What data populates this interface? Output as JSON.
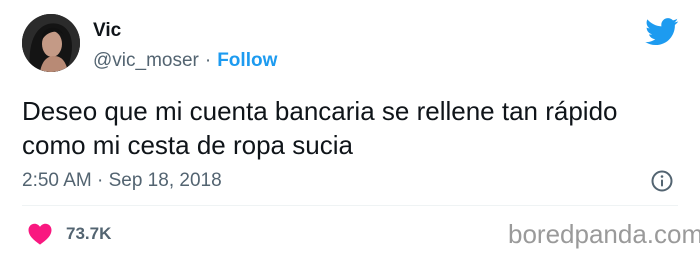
{
  "author": {
    "name": "Vic",
    "handle": "@vic_moser",
    "separator": "·",
    "follow_label": "Follow"
  },
  "tweet": {
    "text_lines": [
      "Deseo que mi cuenta bancaria se rellene tan rápido",
      "como mi cesta de ropa sucia"
    ],
    "timestamp": "2:50 AM · Sep 18, 2018"
  },
  "engagement": {
    "likes": "73.7K",
    "like_icon": "heart-icon",
    "info_icon": "info-icon"
  },
  "branding": {
    "platform_icon": "twitter-bird-icon",
    "watermark": "boredpanda.com"
  },
  "colors": {
    "text": "#0f1419",
    "secondary": "#536471",
    "accent": "#1d9bf0",
    "like": "#f91880",
    "watermark": "#9a9a9a"
  }
}
